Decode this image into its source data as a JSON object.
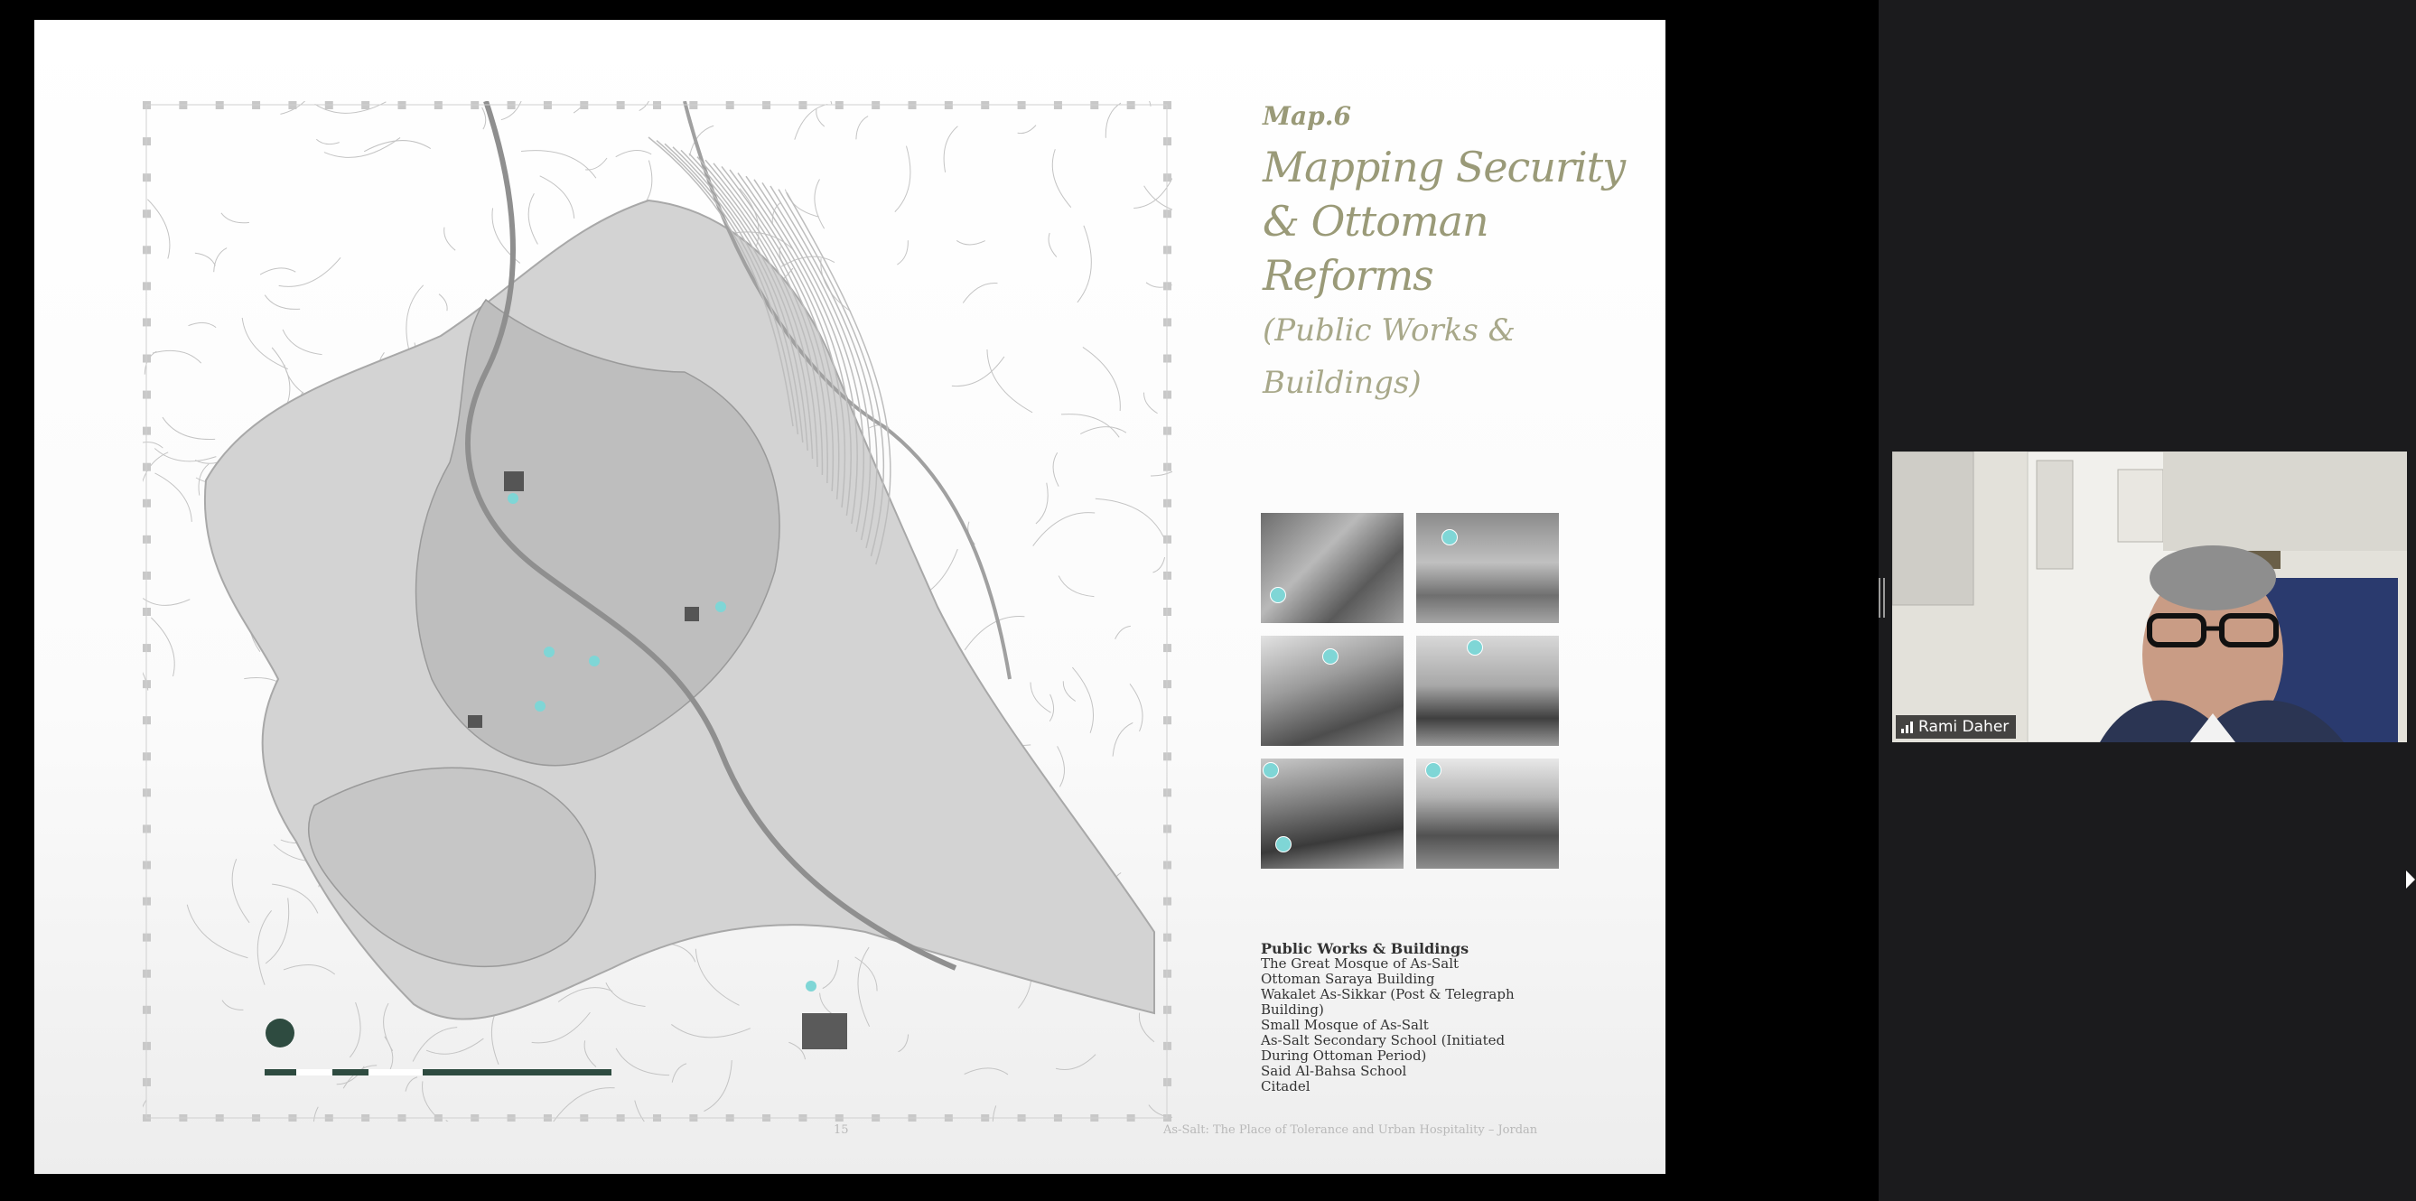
{
  "slide": {
    "map_number": "Map.6",
    "title_lines": [
      "Mapping Security",
      "& Ottoman",
      "Reforms"
    ],
    "subtitle_lines": [
      "(Public Works &",
      "Buildings)"
    ],
    "legend": {
      "title": "Public Works & Buildings",
      "items": [
        "The Great Mosque of As-Salt",
        "Ottoman Saraya Building",
        "Wakalet As-Sikkar (Post & Telegraph",
        "Building)",
        "Small Mosque of As-Salt",
        "As-Salt Secondary School (Initiated",
        "During Ottoman Period)",
        "Said Al-Bahsa School",
        "Citadel"
      ]
    },
    "page_number": "15",
    "footer": "As-Salt: The Place of Tolerance and Urban Hospitality – Jordan",
    "photo_count": 6,
    "accent_color": "#9a9a78",
    "marker_color": "#7fd6d6"
  },
  "participant": {
    "name": "Rami Daher",
    "icon": "signal-bars-icon"
  },
  "icons": {
    "map_north": "north-arrow-icon",
    "scale_bar": "scale-bar-icon",
    "resize": "resize-handle-icon",
    "cursor": "mouse-cursor-icon"
  }
}
